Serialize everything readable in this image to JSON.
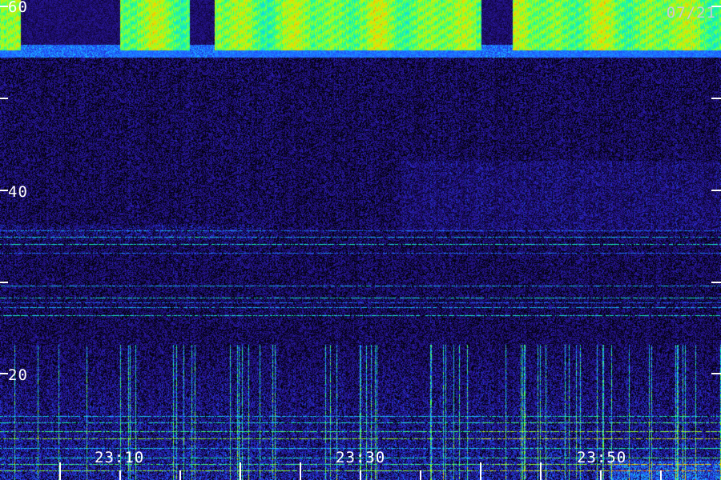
{
  "chart_data": {
    "type": "heatmap",
    "title": "",
    "xlabel": "",
    "ylabel": "",
    "date": "07/21",
    "y_ticks": [
      "60",
      "40",
      "20"
    ],
    "x_ticks": [
      "23:10",
      "23:30",
      "23:50"
    ],
    "y_range": [
      10,
      60
    ],
    "x_range": [
      "23:02",
      "24:02"
    ],
    "colormap": [
      "#000000",
      "#1a0a5e",
      "#2a1aa8",
      "#1f4fff",
      "#19c8ff",
      "#16ff9a",
      "#a8ff16",
      "#ffd000",
      "#ff3a10"
    ],
    "features": [
      {
        "name": "upper band",
        "y_from": 55,
        "y_to": 60,
        "level": "high"
      },
      {
        "name": "mid lines",
        "y_from": 27,
        "y_to": 32,
        "level": "medium"
      },
      {
        "name": "lower band",
        "y_from": 10,
        "y_to": 18,
        "level": "medium-high"
      }
    ]
  }
}
